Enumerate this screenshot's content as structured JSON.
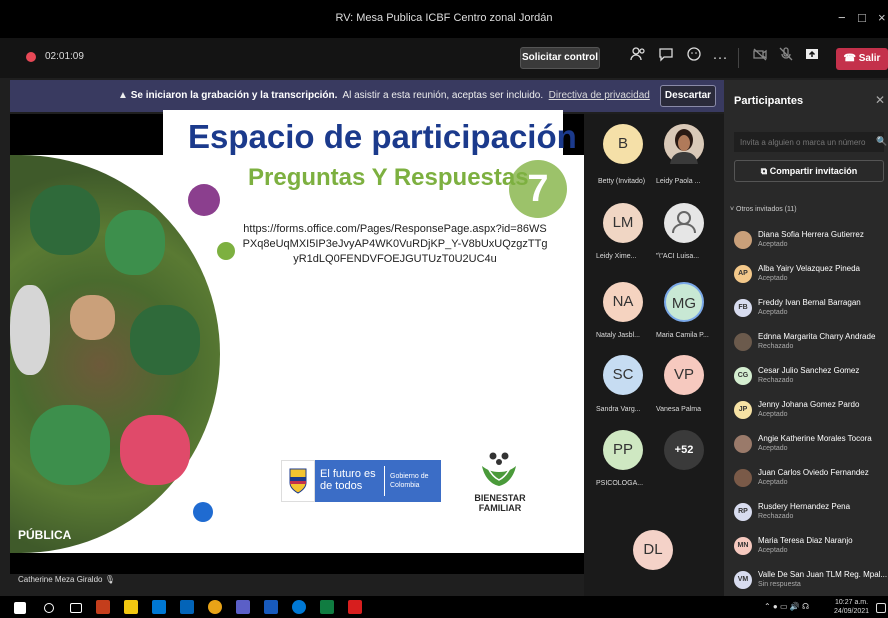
{
  "window": {
    "title": "RV: Mesa Publica ICBF Centro zonal Jordán",
    "minimize": "−",
    "maximize": "□",
    "close": "×"
  },
  "toolbar": {
    "timer": "02:01:09",
    "control_button": "Solicitar control",
    "leave_button": "Salir",
    "more": "···"
  },
  "banner": {
    "bold_text": "Se iniciaron la grabación y la transcripción.",
    "text": "Al asistir a esta reunión, aceptas ser incluido.",
    "link": "Directiva de privacidad",
    "dismiss": "Descartar"
  },
  "slide": {
    "number": "7",
    "title": "Espacio de participación",
    "subtitle": "Preguntas Y Respuestas",
    "url": "https://forms.office.com/Pages/ResponsePage.aspx?id=86WSPXq8eUqMXI5IP3eJvyAP4WK0VuRDjKP_Y-V8bUxUQzgzTTgyR1dLQ0FENDVFOEJGUTUzT0U2UC4u",
    "gov_text": "El futuro es de todos",
    "gov_sub": "Gobierno de Colombia",
    "bf_text": "BIENESTAR FAMILIAR",
    "label": "PÚBLICA",
    "presenter": "Catherine Meza Giraldo"
  },
  "gallery": [
    {
      "initials": "B",
      "name": "Betty (Invitado)",
      "color": "#f5e0a8"
    },
    {
      "initials": "",
      "name": "Leidy Paola ...",
      "color": "#5a3a2a"
    },
    {
      "initials": "LM",
      "name": "Leidy Xime...",
      "color": "#f0d6c4"
    },
    {
      "initials": "",
      "name": "\"\\\"ACI Luisa...",
      "color": "#e6e6e6"
    },
    {
      "initials": "NA",
      "name": "Nataly Jasbl...",
      "color": "#f5d3c0"
    },
    {
      "initials": "MG",
      "name": "Maria Camila P...",
      "color": "#c8e8d4"
    },
    {
      "initials": "SC",
      "name": "Sandra Varg...",
      "color": "#c6dcf2"
    },
    {
      "initials": "VP",
      "name": "Vanesa Palma",
      "color": "#f6c9bf"
    },
    {
      "initials": "PP",
      "name": "PSICOLOGA...",
      "color": "#cfe8c2"
    },
    {
      "initials": "+52",
      "name": "",
      "color": "#3a3a3a"
    },
    {
      "initials": "DL",
      "name": "",
      "color": "#f4d2c8"
    }
  ],
  "panel": {
    "title": "Participantes",
    "invite_placeholder": "Invita a alguien o marca un número",
    "share_button": "Compartir invitación",
    "section": "Otros invitados (11)",
    "people": [
      {
        "initials": "",
        "name": "Diana Sofia Herrera Gutierrez",
        "status": "Aceptado",
        "color": "#c9a07a"
      },
      {
        "initials": "AP",
        "name": "Alba Yairy Velazquez Pineda",
        "status": "Aceptado",
        "color": "#f3c88a"
      },
      {
        "initials": "FB",
        "name": "Freddy Ivan Bernal Barragan",
        "status": "Aceptado",
        "color": "#d8dcef"
      },
      {
        "initials": "",
        "name": "Ednna Margarita Charry Andrade",
        "status": "Rechazado",
        "color": "#6b5a4c"
      },
      {
        "initials": "CG",
        "name": "Cesar Julio Sanchez Gomez",
        "status": "Rechazado",
        "color": "#d4eed0"
      },
      {
        "initials": "JP",
        "name": "Jenny Johana Gomez Pardo",
        "status": "Aceptado",
        "color": "#f6e2a4"
      },
      {
        "initials": "",
        "name": "Angie Katherine Morales Tocora",
        "status": "Aceptado",
        "color": "#9a7a6a"
      },
      {
        "initials": "",
        "name": "Juan Carlos Oviedo Fernandez",
        "status": "Aceptado",
        "color": "#7a5a48"
      },
      {
        "initials": "RP",
        "name": "Rusdery Hernandez Pena",
        "status": "Rechazado",
        "color": "#d8dcef"
      },
      {
        "initials": "MN",
        "name": "Maria Teresa Diaz Naranjo",
        "status": "Aceptado",
        "color": "#f6c9bf"
      },
      {
        "initials": "VM",
        "name": "Valle De San Juan TLM Reg. Mpal...",
        "status": "Sin respuesta",
        "color": "#d8dcef"
      }
    ]
  },
  "taskbar": {
    "time": "10:27 a.m.",
    "date": "24/09/2021"
  }
}
